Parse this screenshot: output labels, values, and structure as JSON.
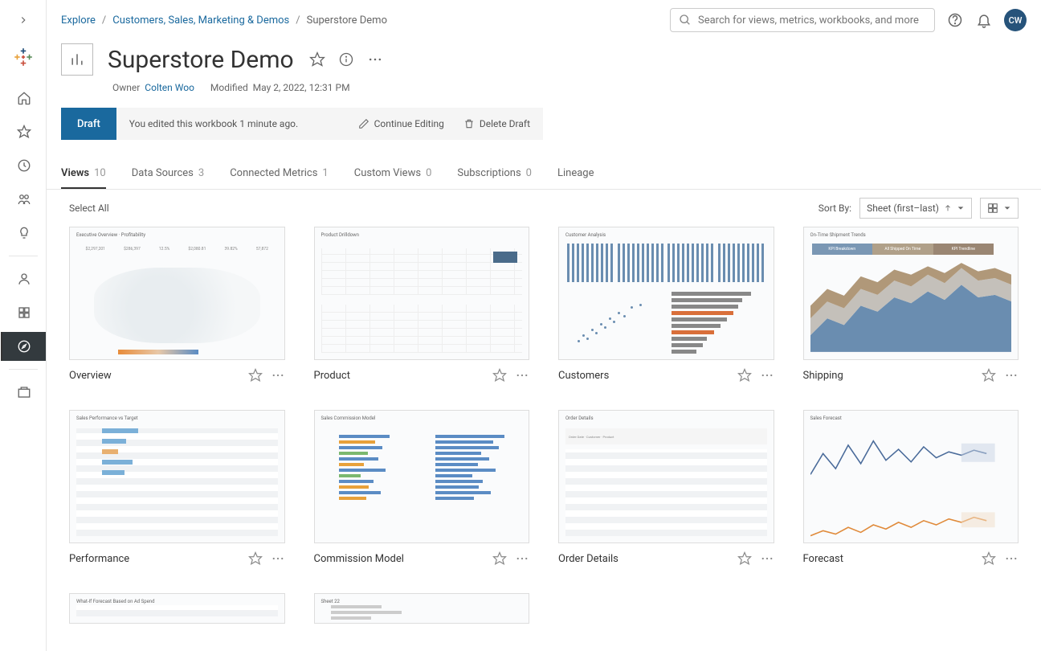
{
  "breadcrumb": {
    "explore": "Explore",
    "project": "Customers, Sales, Marketing & Demos",
    "current": "Superstore Demo"
  },
  "search": {
    "placeholder": "Search for views, metrics, workbooks, and more"
  },
  "avatar": "CW",
  "header": {
    "title": "Superstore Demo",
    "owner_label": "Owner",
    "owner_name": "Colten Woo",
    "modified_label": "Modified",
    "modified_value": "May 2, 2022, 12:31 PM"
  },
  "draft": {
    "badge": "Draft",
    "message": "You edited this workbook 1 minute ago.",
    "continue": "Continue Editing",
    "delete": "Delete Draft"
  },
  "tabs": [
    {
      "label": "Views",
      "count": "10"
    },
    {
      "label": "Data Sources",
      "count": "3"
    },
    {
      "label": "Connected Metrics",
      "count": "1"
    },
    {
      "label": "Custom Views",
      "count": "0"
    },
    {
      "label": "Subscriptions",
      "count": "0"
    },
    {
      "label": "Lineage",
      "count": ""
    }
  ],
  "toolbar": {
    "select_all": "Select All",
    "sort_by_label": "Sort By:",
    "sort_value": "Sheet (first–last)"
  },
  "views": [
    {
      "title": "Overview",
      "thumb_hint": "Executive Overview · Profitability"
    },
    {
      "title": "Product",
      "thumb_hint": "Product Drilldown"
    },
    {
      "title": "Customers",
      "thumb_hint": "Customer Analysis"
    },
    {
      "title": "Shipping",
      "thumb_hint": "On-Time Shipment Trends"
    },
    {
      "title": "Performance",
      "thumb_hint": "Sales Performance vs Target"
    },
    {
      "title": "Commission Model",
      "thumb_hint": "Sales Commission Model"
    },
    {
      "title": "Order Details",
      "thumb_hint": "Order Details"
    },
    {
      "title": "Forecast",
      "thumb_hint": "Sales Forecast"
    },
    {
      "title": "",
      "thumb_hint": "What-If Forecast Based on Ad Spend"
    },
    {
      "title": "",
      "thumb_hint": "Sheet 22"
    }
  ],
  "shipping_legend": [
    "KPI Breakdown",
    "All Shipped On Time",
    "KPI Trendline"
  ]
}
